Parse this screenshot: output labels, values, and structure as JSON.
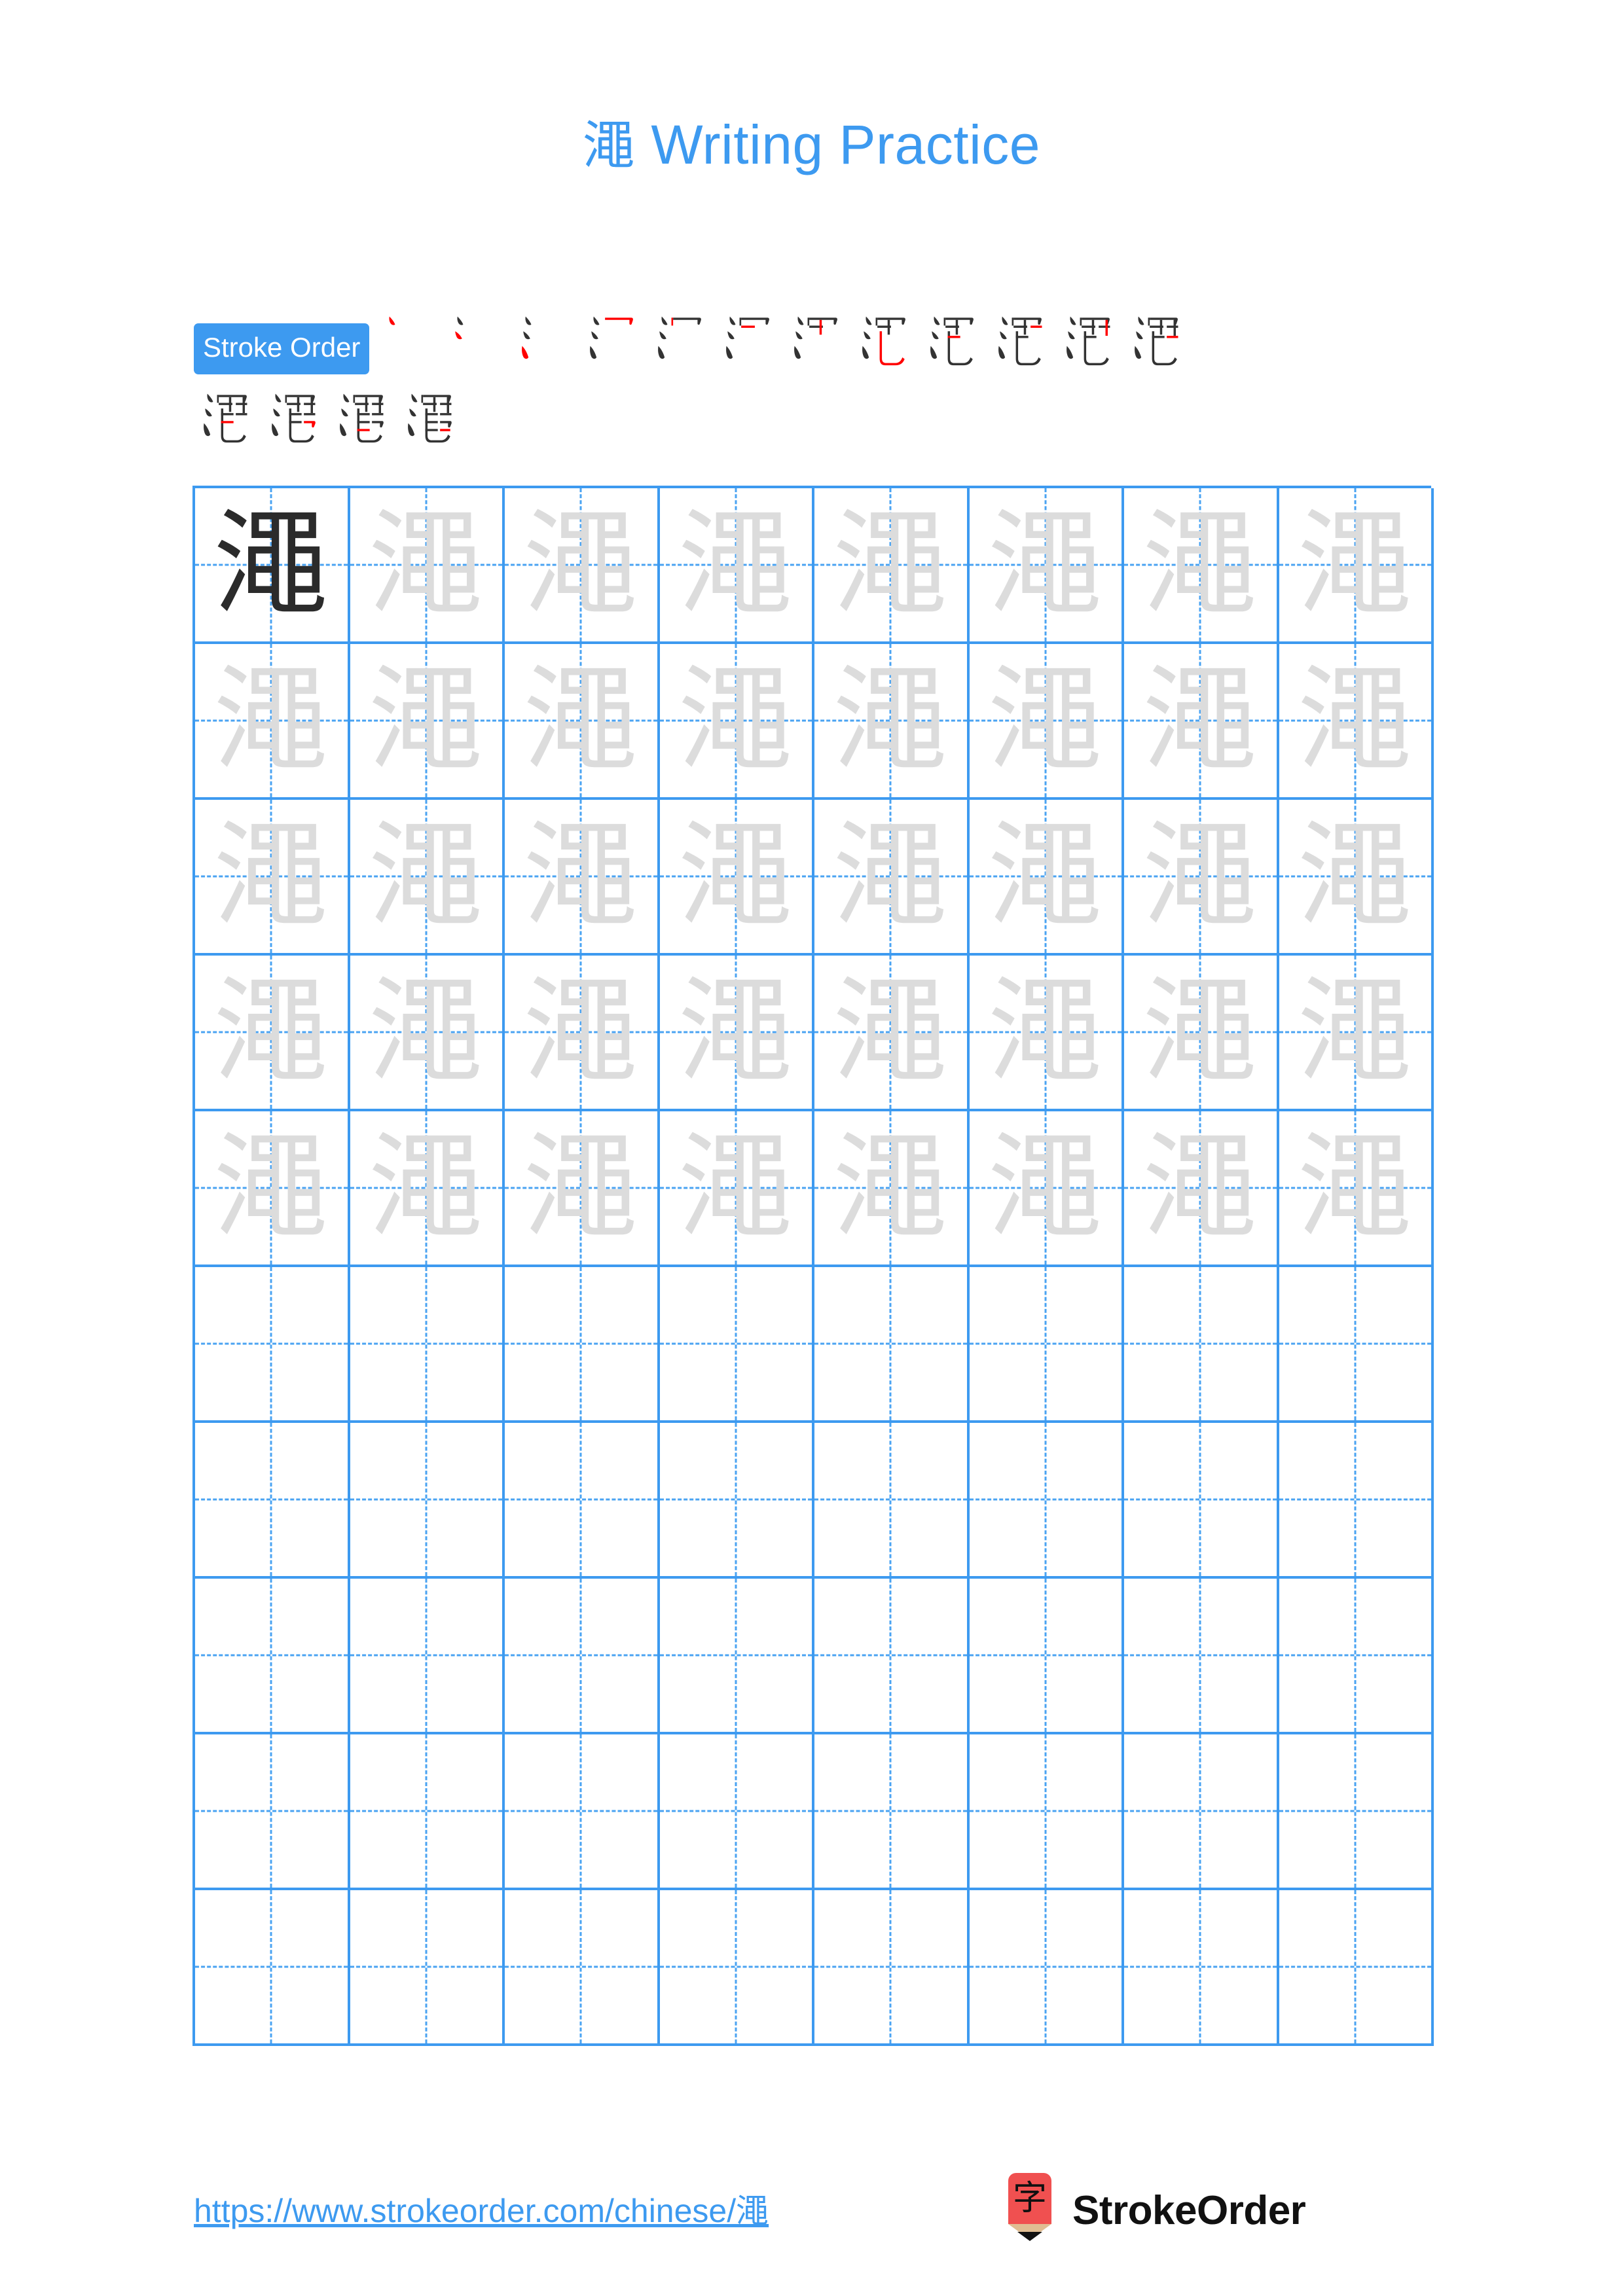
{
  "page": {
    "character": "澠",
    "title_suffix": " Writing Practice",
    "title_full": "澠 Writing Practice"
  },
  "colors": {
    "accent_blue": "#3d9af0",
    "grid_line": "#3d9af0",
    "grid_guide": "#4aa3f2",
    "char_dark": "#2b2b2b",
    "char_faint": "#dcdcdc",
    "stroke_new": "#ff0000",
    "stroke_old": "#333333",
    "logo_red": "#f05050",
    "logo_wood": "#e0bd92",
    "logo_tip": "#111111",
    "page_background": "#ffffff"
  },
  "stroke_order": {
    "badge_label": "Stroke Order",
    "total_strokes": 16,
    "row1_count": 12,
    "row2_count": 4,
    "steps": [
      1,
      2,
      3,
      4,
      5,
      6,
      7,
      8,
      9,
      10,
      11,
      12,
      13,
      14,
      15,
      16
    ]
  },
  "grid": {
    "rows": 10,
    "columns": 8,
    "filled_rows": 5,
    "empty_rows": 5,
    "first_cell_style": "dark",
    "traced_cell_style": "faint",
    "cells": [
      [
        "dark",
        "faint",
        "faint",
        "faint",
        "faint",
        "faint",
        "faint",
        "faint"
      ],
      [
        "faint",
        "faint",
        "faint",
        "faint",
        "faint",
        "faint",
        "faint",
        "faint"
      ],
      [
        "faint",
        "faint",
        "faint",
        "faint",
        "faint",
        "faint",
        "faint",
        "faint"
      ],
      [
        "faint",
        "faint",
        "faint",
        "faint",
        "faint",
        "faint",
        "faint",
        "faint"
      ],
      [
        "faint",
        "faint",
        "faint",
        "faint",
        "faint",
        "faint",
        "faint",
        "faint"
      ],
      [
        "empty",
        "empty",
        "empty",
        "empty",
        "empty",
        "empty",
        "empty",
        "empty"
      ],
      [
        "empty",
        "empty",
        "empty",
        "empty",
        "empty",
        "empty",
        "empty",
        "empty"
      ],
      [
        "empty",
        "empty",
        "empty",
        "empty",
        "empty",
        "empty",
        "empty",
        "empty"
      ],
      [
        "empty",
        "empty",
        "empty",
        "empty",
        "empty",
        "empty",
        "empty",
        "empty"
      ],
      [
        "empty",
        "empty",
        "empty",
        "empty",
        "empty",
        "empty",
        "empty",
        "empty"
      ]
    ]
  },
  "footer": {
    "url": "https://www.strokeorder.com/chinese/澠",
    "brand_name": "StrokeOrder",
    "logo_char": "字",
    "logo_icon": "pencil-icon"
  }
}
